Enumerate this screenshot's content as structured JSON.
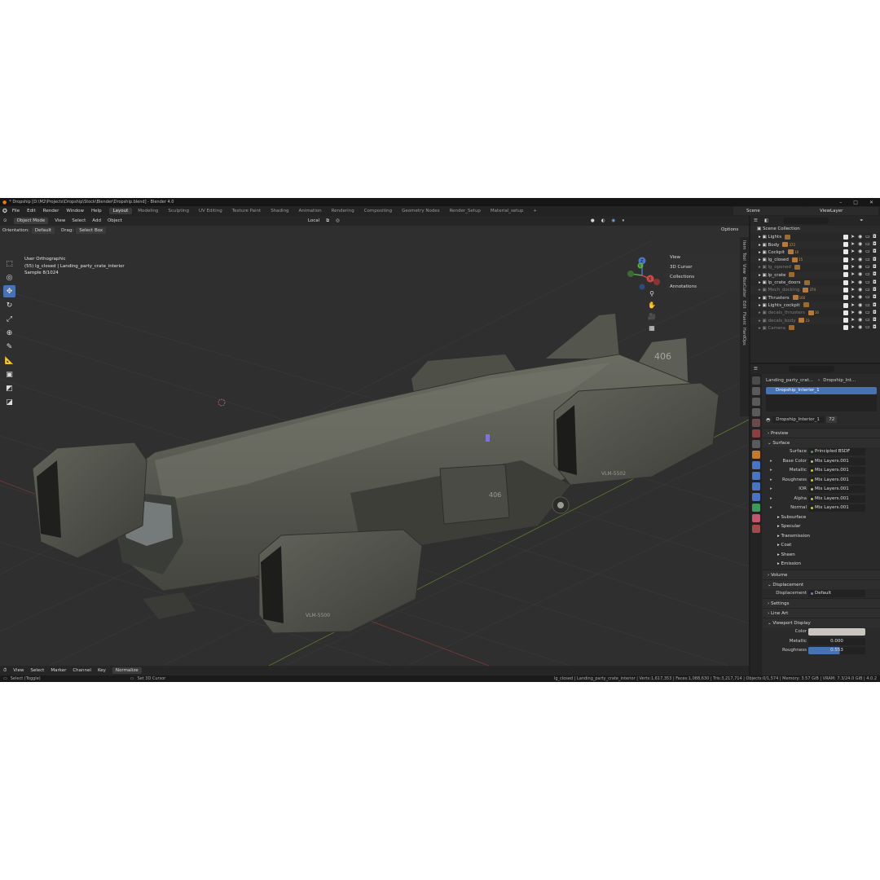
{
  "window": {
    "title": "* Dropship [D:\\M2\\Projects\\Dropship\\Stock\\Blender\\Dropship.blend] - Blender 4.0",
    "controls": [
      "–",
      "□",
      "✕"
    ]
  },
  "menubar": {
    "menus": [
      "File",
      "Edit",
      "Render",
      "Window",
      "Help"
    ],
    "workspaces": [
      "Layout",
      "Modeling",
      "Sculpting",
      "UV Editing",
      "Texture Paint",
      "Shading",
      "Animation",
      "Rendering",
      "Compositing",
      "Geometry Nodes",
      "Render_Setup",
      "Material_setup",
      "+"
    ],
    "active_workspace": "Layout",
    "scene": "Scene",
    "view_layer": "ViewLayer"
  },
  "viewport": {
    "mode": "Object Mode",
    "menus": [
      "View",
      "Select",
      "Add",
      "Object"
    ],
    "transform_space": "Local",
    "orientation_label": "Orientation:",
    "orientation": "Default",
    "drag_label": "Drag:",
    "drag_value": "Select Box",
    "options": "Options",
    "overlay_lines": [
      "User Orthographic",
      "(55) lg_closed | Landing_party_crate_interior",
      "Sample 8/1024"
    ],
    "npanel": [
      "View",
      "3D Cursor",
      "Collections",
      "Annotations"
    ],
    "side_tabs": [
      "Item",
      "Tool",
      "View",
      "BoxCutter",
      "Edit",
      "Fluent",
      "HardOps"
    ],
    "ship_text_tail": "406",
    "ship_text_pod": "VLM-5502",
    "ship_text_pod2": "VLM-5500",
    "ship_text_crate": "406",
    "gizmo_labels": [
      "X",
      "Y",
      "Z"
    ]
  },
  "timeline": {
    "menus": [
      "View",
      "Select",
      "Marker",
      "Channel",
      "Key"
    ],
    "normalize": "Normalize"
  },
  "statusbar": {
    "left": "Select (Toggle)",
    "mid": "Set 3D Cursor",
    "stats": "lg_closed | Landing_party_crate_interior | Verts:1,617,353 | Faces:1,088,630 | Tris:3,217,714 | Objects:0/1,574 | Memory: 3.57 GiB | VRAM: 7.3/24.0 GiB | 4.0.2"
  },
  "outliner": {
    "root": "Scene Collection",
    "items": [
      {
        "name": "Lights",
        "count": "",
        "dim": false
      },
      {
        "name": "Body",
        "count": "372",
        "dim": false
      },
      {
        "name": "Cockpit",
        "count": "10",
        "dim": false
      },
      {
        "name": "lg_closed",
        "count": "15",
        "dim": false
      },
      {
        "name": "lg_opened",
        "count": "",
        "dim": true
      },
      {
        "name": "lp_crate",
        "count": "",
        "dim": false
      },
      {
        "name": "lp_crate_doors",
        "count": "",
        "dim": false
      },
      {
        "name": "Mech_docking",
        "count": "374",
        "dim": true
      },
      {
        "name": "Thrusters",
        "count": "160",
        "dim": false
      },
      {
        "name": "Lights_cockpit",
        "count": "",
        "dim": false
      },
      {
        "name": "decals_thrusters",
        "count": "16",
        "dim": true
      },
      {
        "name": "decals_body",
        "count": "23",
        "dim": true
      },
      {
        "name": "Camera",
        "count": "",
        "dim": true
      }
    ]
  },
  "properties": {
    "breadcrumb": [
      "Landing_party_crat...",
      "Dropship_Int..."
    ],
    "slot": "Dropship_Interior_1",
    "material_name": "Dropship_Interior_1",
    "users": "72",
    "sections": {
      "preview": "Preview",
      "surface": "Surface",
      "volume": "Volume",
      "displacement": "Displacement",
      "settings": "Settings",
      "lineart": "Line Art",
      "viewport_display": "Viewport Display"
    },
    "surface_label": "Surface",
    "surface_value": "Principled BSDF",
    "inputs": [
      {
        "label": "Base Color",
        "value": "Mix Layers.001"
      },
      {
        "label": "Metallic",
        "value": "Mix Layers.001"
      },
      {
        "label": "Roughness",
        "value": "Mix Layers.001"
      },
      {
        "label": "IOR",
        "value": "Mix Layers.001"
      },
      {
        "label": "Alpha",
        "value": "Mix Layers.001"
      },
      {
        "label": "Normal",
        "value": "Mix Layers.001"
      }
    ],
    "subpanels": [
      "Subsurface",
      "Specular",
      "Transmission",
      "Coat",
      "Sheen",
      "Emission"
    ],
    "displacement_label": "Displacement",
    "displacement_value": "Default",
    "vd_color_label": "Color",
    "vd_metallic_label": "Metallic",
    "vd_metallic": "0.000",
    "vd_roughness_label": "Roughness",
    "vd_roughness": "0.553"
  }
}
